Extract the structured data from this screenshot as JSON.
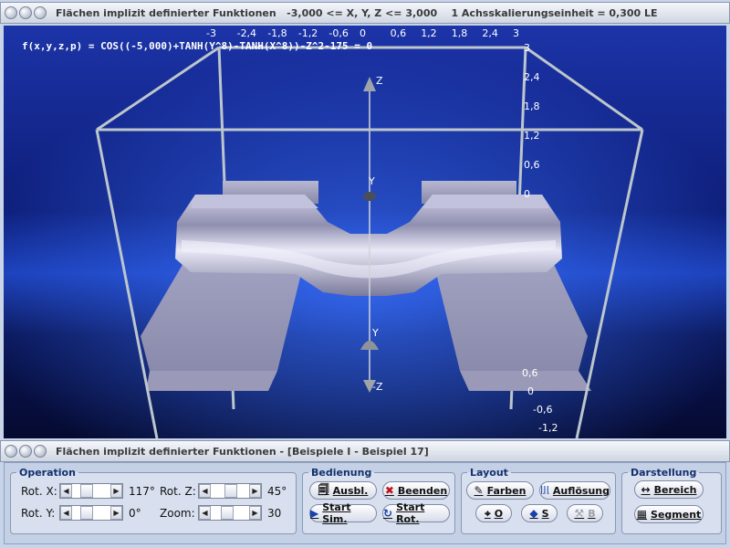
{
  "top_window": {
    "title": "Flächen implizit definierter Funktionen   -3,000 <= X, Y, Z <= 3,000    1 Achsskalierungseinheit = 0,300 LE"
  },
  "scene": {
    "formula": "f(x,y,z,p) = COS((-5,000)+TANH(Y^8)-TANH(X^8))-Z^2-175 = 0",
    "top_ticks": [
      "-3",
      "-2,4",
      "-1,8",
      "-1,2",
      "-0,6",
      "0",
      "0,6",
      "1,2",
      "1,8",
      "2,4",
      "3"
    ],
    "right_ticks_upper": [
      "3",
      "2,4",
      "1,8",
      "1,2",
      "0,6",
      "0"
    ],
    "right_ticks_lower": [
      "0,6",
      "0",
      "-0,6",
      "-1,2"
    ],
    "axis_labels": {
      "z": "Z",
      "y_top": "Y",
      "y_bottom": "Y",
      "neg_z": "-Z"
    },
    "colors": {
      "background_top": "#1a2f9e",
      "background_mid": "#0a1660",
      "surface": "#a9a9c8"
    }
  },
  "bottom_window": {
    "title": "Flächen implizit definierter Funktionen - [Beispiele I - Beispiel 17]"
  },
  "controls": {
    "operation": {
      "legend": "Operation",
      "rot_x_label": "Rot. X:",
      "rot_x_value": "117°",
      "rot_y_label": "Rot. Y:",
      "rot_y_value": "0°",
      "rot_z_label": "Rot. Z:",
      "rot_z_value": "45°",
      "zoom_label": "Zoom:",
      "zoom_value": "30"
    },
    "bedienung": {
      "legend": "Bedienung",
      "ausbl": "Ausbl.",
      "beenden": "Beenden",
      "start_sim": "Start Sim.",
      "start_rot": "Start Rot."
    },
    "layout": {
      "legend": "Layout",
      "farben": "Farben",
      "aufloesung": "Auflösung",
      "o": "O",
      "s": "S",
      "b": "B"
    },
    "darstellung": {
      "legend": "Darstellung",
      "bereich": "Bereich",
      "segment": "Segment"
    }
  }
}
